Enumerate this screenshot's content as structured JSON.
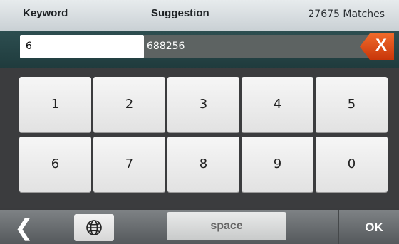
{
  "header": {
    "keyword_label": "Keyword",
    "suggestion_label": "Suggestion",
    "matches_text": "27675 Matches"
  },
  "input": {
    "value": "6",
    "suggestion": "688256",
    "clear_label": "X"
  },
  "keypad": {
    "keys": [
      "1",
      "2",
      "3",
      "4",
      "5",
      "6",
      "7",
      "8",
      "9",
      "0"
    ]
  },
  "bottom_bar": {
    "back_label": "❮",
    "globe_icon": "globe-icon",
    "space_label": "space",
    "ok_label": "OK"
  },
  "colors": {
    "clear_button": "#e04a12",
    "header_bg": "#d8dde0",
    "input_strip": "#244446"
  }
}
